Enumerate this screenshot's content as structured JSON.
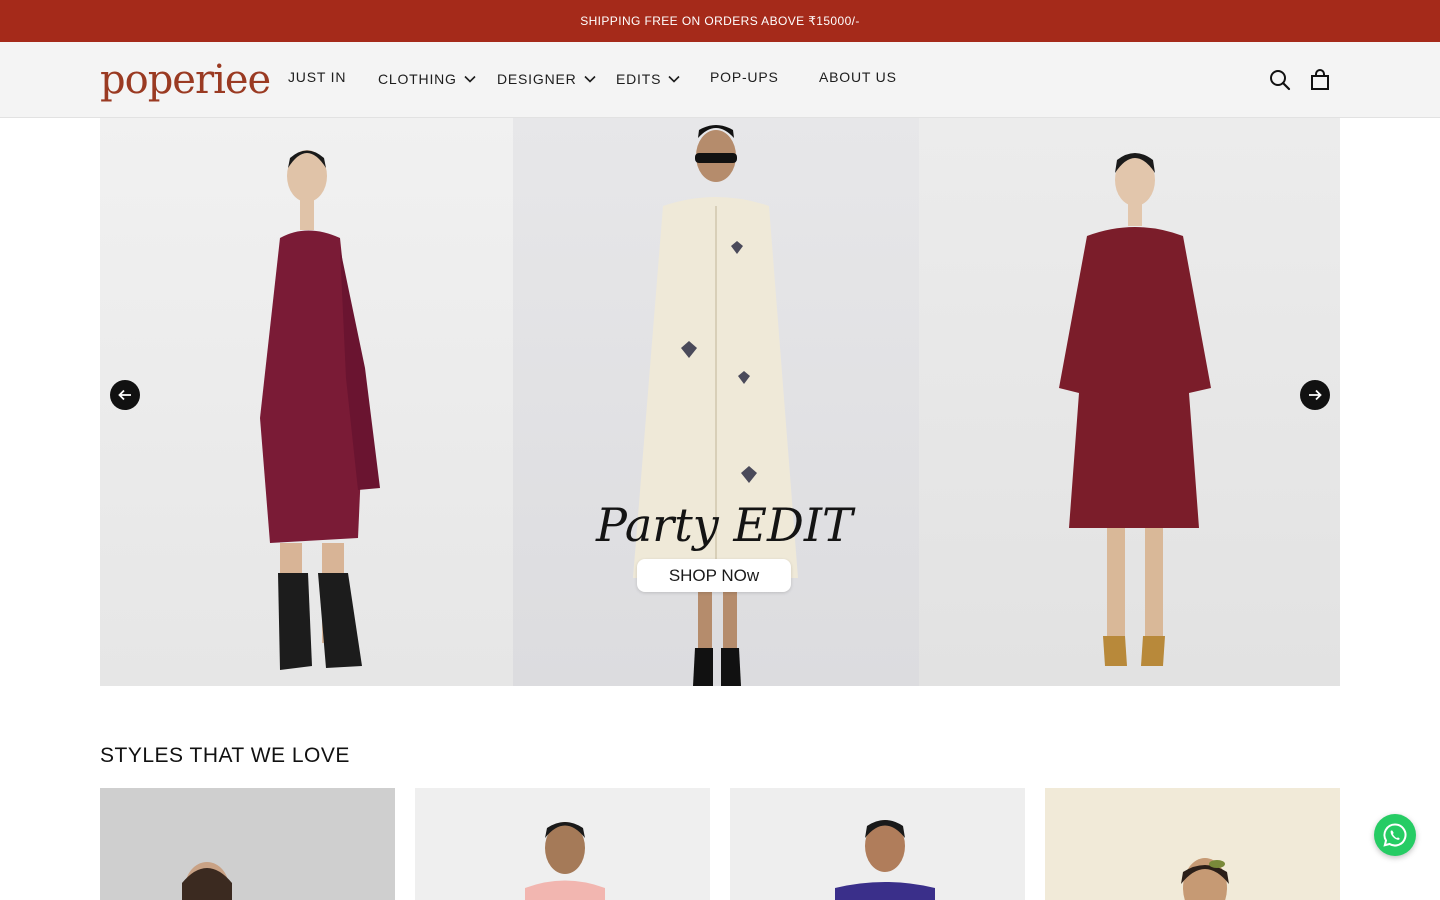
{
  "announcement": "SHIPPING FREE ON ORDERS ABOVE ₹15000/-",
  "brand": {
    "logo_text": "poperiee",
    "color": "#9a3a22"
  },
  "colors": {
    "announcement_bg": "#a52a1a",
    "header_bg": "#f4f4f4",
    "whatsapp": "#26cc64"
  },
  "nav": {
    "items": [
      {
        "label": "JUST IN",
        "dropdown": false
      },
      {
        "label": "CLOTHING",
        "dropdown": true
      },
      {
        "label": "DESIGNER",
        "dropdown": true
      },
      {
        "label": "EDITS",
        "dropdown": true
      },
      {
        "label": "POP-UPS",
        "dropdown": false
      },
      {
        "label": "ABOUT US",
        "dropdown": false
      }
    ],
    "icons": [
      "search-icon",
      "cart-icon",
      "chevron-down-icon"
    ]
  },
  "hero": {
    "title": "Party EDIT",
    "cta": "SHOP NOw",
    "prev_icon": "arrow-left-icon",
    "next_icon": "arrow-right-icon"
  },
  "styles_section": {
    "title": "STYLES THAT WE LOVE"
  },
  "whatsapp": {
    "icon": "whatsapp-icon"
  }
}
